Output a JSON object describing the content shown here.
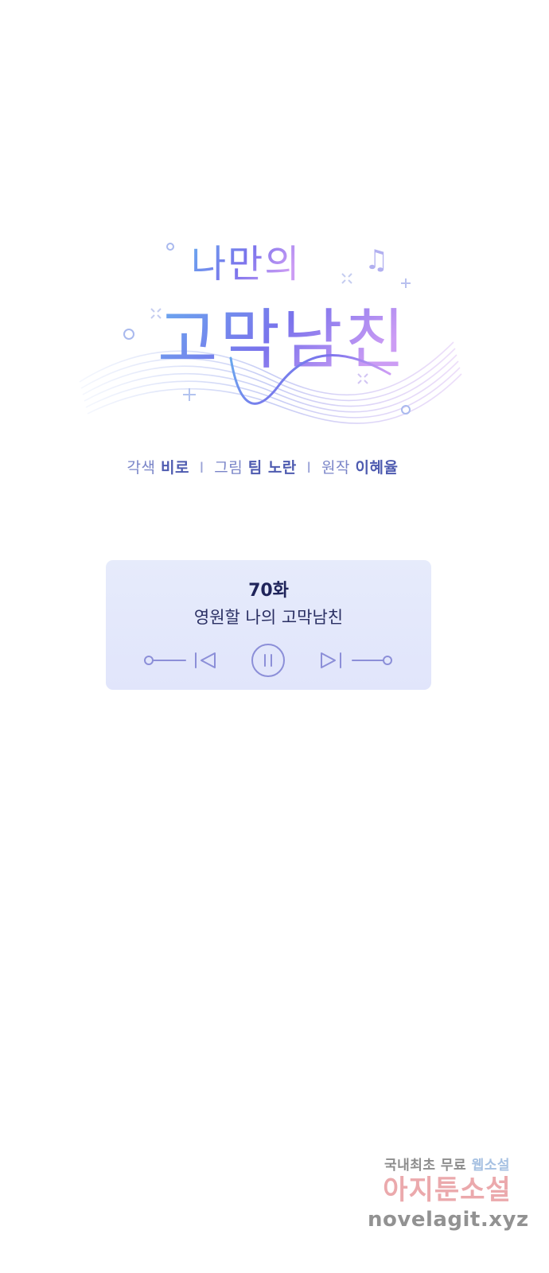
{
  "logo": {
    "line1": "나만의",
    "line2": "고막남친",
    "music_note": "♫",
    "colors": {
      "from": "#6aa7ee",
      "mid": "#7a74ec",
      "to": "#c89af2"
    }
  },
  "credits": {
    "adapt_label": "각색",
    "adapt_name": "비로",
    "sep1": "I",
    "art_label": "그림",
    "art_name": "팀 노란",
    "sep2": "I",
    "original_label": "원작",
    "original_name": "이혜율"
  },
  "episode": {
    "number": "70화",
    "title": "영원할 나의 고막남친"
  },
  "player": {
    "icons": [
      "slider-left-icon",
      "previous-icon",
      "pause-icon",
      "next-icon",
      "slider-right-icon"
    ],
    "accent": "#8c8fd8"
  },
  "watermark": {
    "line1_a": "국내최초 무료",
    "line1_b": "웹소설",
    "line2": "아지툰소설",
    "line3": "novelagit.xyz"
  }
}
